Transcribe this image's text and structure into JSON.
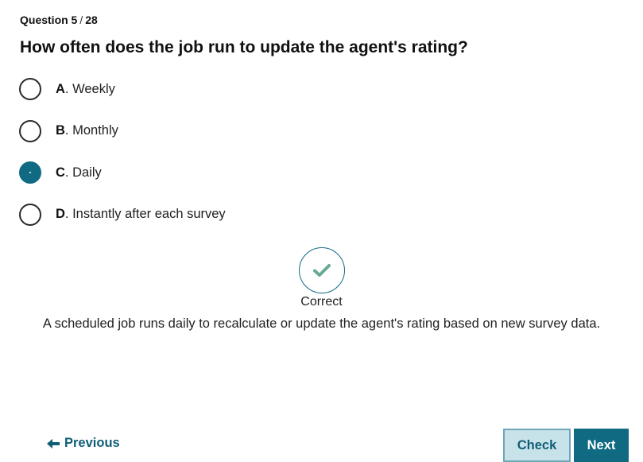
{
  "header": {
    "question_label": "Question 5",
    "separator": "/",
    "total": "28"
  },
  "question": {
    "text": "How often does the job run to update the agent's rating?"
  },
  "options": [
    {
      "letter": "A",
      "text": ". Weekly",
      "selected": false
    },
    {
      "letter": "B",
      "text": ". Monthly",
      "selected": false
    },
    {
      "letter": "C",
      "text": ". Daily",
      "selected": true
    },
    {
      "letter": "D",
      "text": ". Instantly after each survey",
      "selected": false
    }
  ],
  "feedback": {
    "icon": "checkmark-icon",
    "status": "Correct",
    "explanation": "A scheduled job runs daily to recalculate or update the agent's rating based on new survey data."
  },
  "navigation": {
    "previous_label": "Previous",
    "check_label": "Check",
    "next_label": "Next"
  },
  "colors": {
    "accent": "#0f6a82",
    "check_fill": "#6aaa93",
    "check_button_bg": "#c8e2ea"
  }
}
